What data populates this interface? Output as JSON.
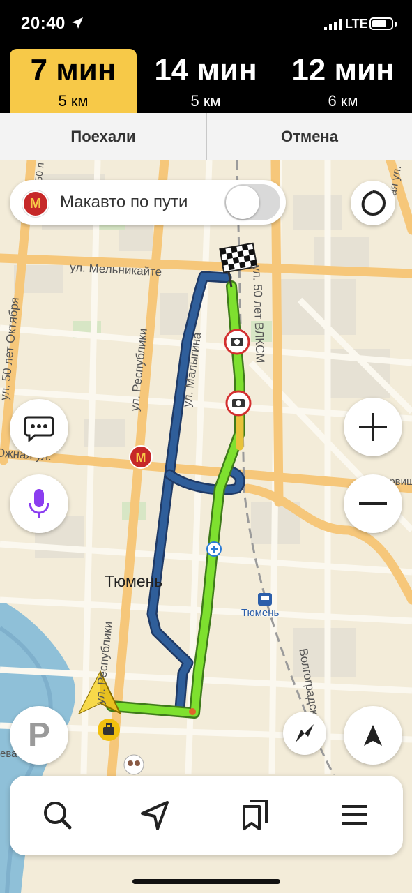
{
  "status_bar": {
    "time": "20:40",
    "network": "LTE"
  },
  "routes": [
    {
      "time": "7 мин",
      "distance": "5 км",
      "selected": true
    },
    {
      "time": "14 мин",
      "distance": "5 км",
      "selected": false
    },
    {
      "time": "12 мин",
      "distance": "6 км",
      "selected": false
    }
  ],
  "actions": {
    "go_label": "Поехали",
    "cancel_label": "Отмена"
  },
  "overlay": {
    "mcdrive_label": "Макавто по пути",
    "mcdrive_toggle_on": false,
    "mcdonalds_glyph": "M"
  },
  "map": {
    "labels": {
      "melnikaite": "ул. Мельникайте",
      "malygina": "ул. Малыгина",
      "respubliki": "ул. Республики",
      "respubliki_south": "ул. Республики",
      "fifty_october": "ул. 50 лет Октября",
      "fifty_vlksm": "ул. 50 лет ВЛКСМ",
      "yuzhnaya": "Южная ул.",
      "volgogradskaya": "Волгоградская ул.",
      "city": "Тюмень",
      "station": "Тюмень",
      "top_edge": "ул. 50 л",
      "right_top": "ая ул.",
      "right_mid": "Червиш",
      "left_edge": "ева"
    },
    "colors": {
      "route_selected": "#7ee02f",
      "route_alternative": "#2f5e9a",
      "major_road": "#f6c77a",
      "river": "#8fc0d8",
      "background": "#f3ecd9"
    }
  },
  "controls": {
    "parking_label": "P"
  },
  "bottom_nav": {
    "icons": [
      "search-icon",
      "navigation-icon",
      "bookmarks-icon",
      "menu-icon"
    ]
  }
}
